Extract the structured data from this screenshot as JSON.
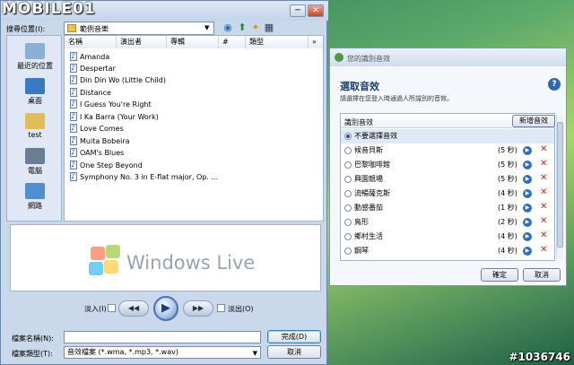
{
  "watermark": {
    "logo": "MOBILE01",
    "stamp": "#1036746"
  },
  "open_dialog": {
    "look_in_label": "搜尋位置(I):",
    "look_in_value": "範例音樂",
    "places": [
      "最近的位置",
      "桌面",
      "test",
      "電腦",
      "網路"
    ],
    "columns": [
      "名稱",
      "演出者",
      "專輯",
      "#",
      "類型"
    ],
    "columns_more": "»",
    "files": [
      "Amanda",
      "Despertar",
      "Din Din Wo (Little Child)",
      "Distance",
      "I Guess You're Right",
      "I Ka Barra (Your Work)",
      "Love Comes",
      "Muita Bobeira",
      "OAM's Blues",
      "One Step Beyond",
      "Symphony No. 3 in E-flat major, Op. ..."
    ],
    "player_brand": "Windows Live",
    "fade_in_label": "淡入(I)",
    "fade_out_label": "淡出(O)",
    "prev_glyph": "◀◀",
    "next_glyph": "▶▶",
    "play_glyph": "▶",
    "filename_label": "檔案名稱(N):",
    "filename_value": "",
    "filetype_label": "檔案類型(T):",
    "filetype_value": "音效檔案 (*.wma, *.mp3, *.wav)",
    "done_button": "完成(D)",
    "cancel_button": "取消",
    "min_glyph": "─",
    "close_glyph": "✕"
  },
  "sound_dialog": {
    "title_bar": "您的識別音效",
    "heading": "選取音效",
    "subtitle": "請選擇在您登入時通過人所識別的音效。",
    "list_header": "識別音效",
    "new_button": "新增音效",
    "help_glyph": "?",
    "items": [
      {
        "name": "不要選擇音效",
        "duration": "",
        "selected": true
      },
      {
        "name": "候音貝斯",
        "duration": "(5 秒)",
        "selected": false
      },
      {
        "name": "巴黎咖啡館",
        "duration": "(5 秒)",
        "selected": false
      },
      {
        "name": "興園競場",
        "duration": "(5 秒)",
        "selected": false
      },
      {
        "name": "流暢薩克斯",
        "duration": "(4 秒)",
        "selected": false
      },
      {
        "name": "動感番茄",
        "duration": "(1 秒)",
        "selected": false
      },
      {
        "name": "鳥形",
        "duration": "(2 秒)",
        "selected": false
      },
      {
        "name": "鄉村生活",
        "duration": "(4 秒)",
        "selected": false
      },
      {
        "name": "鋼琴",
        "duration": "(4 秒)",
        "selected": false
      }
    ],
    "play_glyph": "▶",
    "delete_glyph": "✕",
    "ok_button": "確定",
    "cancel_button": "取消"
  }
}
